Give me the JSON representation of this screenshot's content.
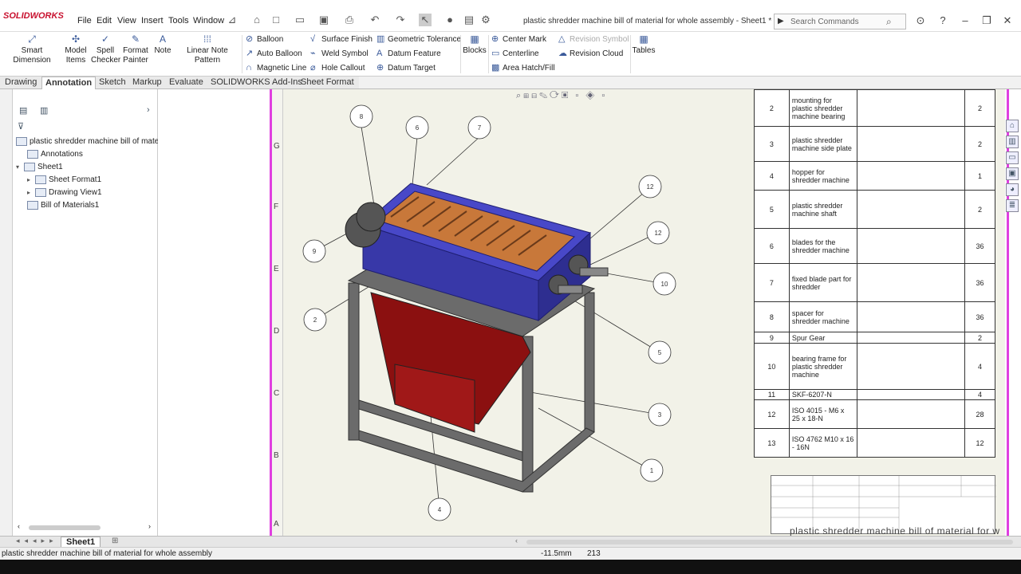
{
  "app": {
    "logo": "SOLIDWORKS",
    "document_title": "plastic shredder machine bill of material for whole assembly - Sheet1 *"
  },
  "menu": [
    "File",
    "Edit",
    "View",
    "Insert",
    "Tools",
    "Window"
  ],
  "search": {
    "placeholder": "Search Commands"
  },
  "ribbon": {
    "big_buttons": [
      {
        "label1": "Smart Dimension",
        "label2": "",
        "icon": "smart-dimension-icon"
      },
      {
        "label1": "Model",
        "label2": "Items",
        "icon": "model-items-icon"
      },
      {
        "label1": "Spell",
        "label2": "Checker",
        "icon": "spell-checker-icon"
      },
      {
        "label1": "Format",
        "label2": "Painter",
        "icon": "format-painter-icon"
      },
      {
        "label1": "Note",
        "label2": "",
        "icon": "note-icon"
      },
      {
        "label1": "Linear Note Pattern",
        "label2": "",
        "icon": "linear-note-pattern-icon"
      }
    ],
    "col1": [
      "Balloon",
      "Auto Balloon",
      "Magnetic Line"
    ],
    "col2": [
      "Surface Finish",
      "Weld Symbol",
      "Hole Callout"
    ],
    "col3": [
      "Geometric Tolerance",
      "Datum Feature",
      "Datum Target"
    ],
    "blocks": "Blocks",
    "col4": [
      "Center Mark",
      "Centerline",
      "Area Hatch/Fill"
    ],
    "col5": [
      "Revision Symbol",
      "Revision Cloud"
    ],
    "tables": "Tables"
  },
  "tabs": [
    "Drawing",
    "Annotation",
    "Sketch",
    "Markup",
    "Evaluate",
    "SOLIDWORKS Add-Ins",
    "Sheet Format"
  ],
  "active_tab": "Annotation",
  "tree": {
    "root": "plastic shredder machine bill of mate",
    "items": [
      "Annotations",
      "Sheet1",
      "Sheet Format1",
      "Drawing View1",
      "Bill of Materials1"
    ]
  },
  "zones_left": [
    "G",
    "F",
    "E",
    "D",
    "C",
    "B",
    "A"
  ],
  "bom": [
    {
      "no": "2",
      "part": "mounting for plastic shredder machine bearing",
      "qty": "2"
    },
    {
      "no": "3",
      "part": "plastic shredder machine side plate",
      "qty": "2"
    },
    {
      "no": "4",
      "part": "hopper for shredder machine",
      "qty": "1"
    },
    {
      "no": "5",
      "part": "plastic shredder machine shaft",
      "qty": "2"
    },
    {
      "no": "6",
      "part": "blades for the shredder machine",
      "qty": "36"
    },
    {
      "no": "7",
      "part": "fixed blade part for shredder",
      "qty": "36"
    },
    {
      "no": "8",
      "part": "spacer for shredder machine",
      "qty": "36"
    },
    {
      "no": "9",
      "part": "Spur Gear",
      "qty": "2"
    },
    {
      "no": "10",
      "part": "bearing frame for plastic shredder machine",
      "qty": "4"
    },
    {
      "no": "11",
      "part": "SKF-6207-N",
      "qty": "4"
    },
    {
      "no": "12",
      "part": "ISO 4015 - M6 x 25 x 18-N",
      "qty": "28"
    },
    {
      "no": "13",
      "part": "ISO 4762 M10 x 16 - 16N",
      "qty": "12"
    }
  ],
  "balloons": [
    "8",
    "6",
    "7",
    "12",
    "12",
    "9",
    "10",
    "2",
    "5",
    "3",
    "1",
    "4"
  ],
  "sheet_caption": "plastic shredder machine bill of material for w",
  "sheet_tab": "Sheet1",
  "status": {
    "text": "plastic shredder machine bill of material for whole assembly",
    "x": "-11.5mm",
    "y": "213"
  },
  "colors": {
    "accent_pink": "#e040e0",
    "hopper": "#8b1010",
    "housing": "#4848c8",
    "blades": "#c8783a"
  }
}
